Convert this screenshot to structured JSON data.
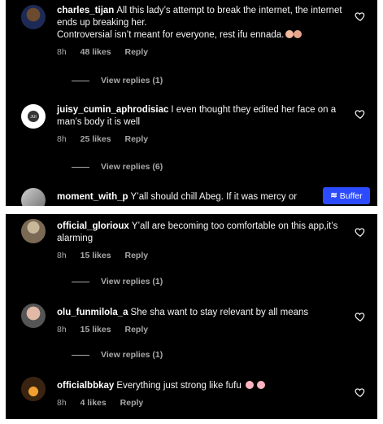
{
  "top_panel": {
    "comments": [
      {
        "username": "charles_tijan",
        "text": "All this lady’s attempt to break the internet, the internet ends up breaking her.",
        "text2": "Controversial isn’t meant for everyone, rest ifu ennada.",
        "time": "8h",
        "likes": "48 likes",
        "reply": "Reply",
        "view_replies": "View replies (1)"
      },
      {
        "username": "juisy_cumin_aphrodisiac",
        "text": "I even thought they edited her face on a man’s body it is well",
        "time": "8h",
        "likes": "25 likes",
        "reply": "Reply",
        "view_replies": "View replies (6)"
      },
      {
        "username": "moment_with_p",
        "text": "Y’all should chill Abeg. If it was mercy or"
      }
    ],
    "buffer_label": "Buffer"
  },
  "bottom_panel": {
    "comments": [
      {
        "username": "official_glorioux",
        "text": "Y’all are becoming too comfortable on this app,it’s alarming",
        "time": "8h",
        "likes": "15 likes",
        "reply": "Reply",
        "view_replies": "View replies (1)"
      },
      {
        "username": "olu_funmilola_a",
        "text": "She sha want to stay relevant by all means",
        "time": "8h",
        "likes": "15 likes",
        "reply": "Reply",
        "view_replies": "View replies (1)"
      },
      {
        "username": "officialbbkay",
        "text": "Everything just strong like fufu",
        "time": "8h",
        "likes": "4 likes",
        "reply": "Reply"
      }
    ]
  },
  "icons": {
    "like": "heart-outline-icon",
    "buffer": "buffer-stack-icon"
  },
  "colors": {
    "background": "#000000",
    "text": "#f5f5f5",
    "muted": "#a8a8a8",
    "buffer": "#2c4bff"
  }
}
